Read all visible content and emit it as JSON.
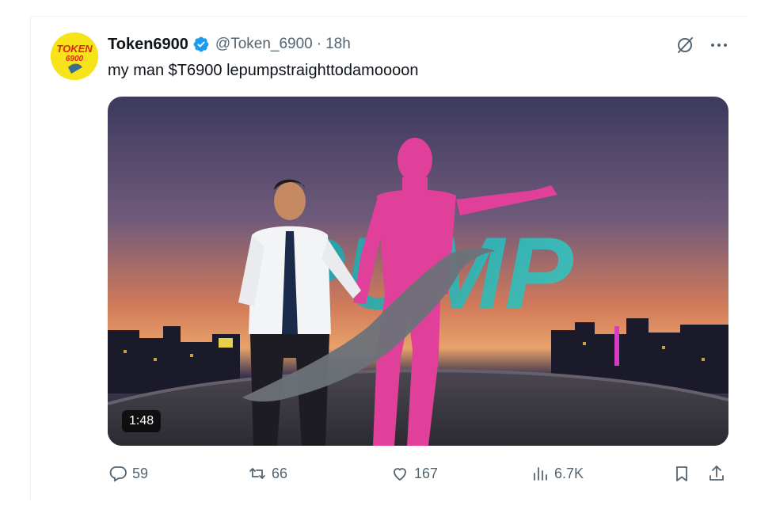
{
  "tweet": {
    "display_name": "Token6900",
    "handle": "@Token_6900",
    "separator": "·",
    "time": "18h",
    "text": "my man $T6900 lepumpstraighttodamoooon",
    "avatar_text_top": "TOKEN",
    "avatar_text_bottom": "6900"
  },
  "media": {
    "overlay_word": "PUMP",
    "duration": "1:48"
  },
  "actions": {
    "replies": "59",
    "retweets": "66",
    "likes": "167",
    "views": "6.7K"
  },
  "icons": [
    "verified-badge-icon",
    "grok-icon",
    "more-icon",
    "reply-icon",
    "retweet-icon",
    "like-icon",
    "views-icon",
    "bookmark-icon",
    "share-icon"
  ],
  "colors": {
    "verified": "#1d9bf0",
    "text_secondary": "#536471",
    "avatar_bg": "#f7e319",
    "avatar_red": "#e0241b"
  }
}
